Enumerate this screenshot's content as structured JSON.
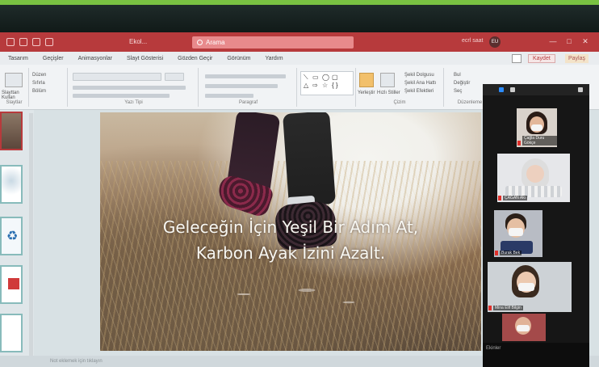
{
  "window": {
    "doc_title": "Ekol...",
    "search_placeholder": "Arama",
    "user_name": "ecrl saat",
    "user_initials": "EU",
    "control_minimize": "—",
    "control_maximize": "□",
    "control_close": "✕"
  },
  "tabs": [
    {
      "label": "Tasarım",
      "active": false
    },
    {
      "label": "Geçişler",
      "active": false
    },
    {
      "label": "Animasyonlar",
      "active": false
    },
    {
      "label": "Slayt Gösterisi",
      "active": false
    },
    {
      "label": "Gözden Geçir",
      "active": false
    },
    {
      "label": "Görünüm",
      "active": false
    },
    {
      "label": "Yardım",
      "active": false
    }
  ],
  "tab_actions": {
    "record_label": "Kaydet",
    "share_label": "Paylaş"
  },
  "ribbon": {
    "groups": [
      {
        "label": "Slaytlar"
      },
      {
        "label": "Yazı Tipi"
      },
      {
        "label": "Paragraf"
      },
      {
        "label": "Çizim"
      },
      {
        "label": "Düzenleme"
      }
    ],
    "new_slide_label": "Slayttan Kullan",
    "layout_label": "Düzen",
    "reset_label": "Sıfırla",
    "section_label": "Bölüm",
    "arrange_label": "Yerleştir",
    "quick_styles_label": "Hızlı Stiller",
    "shape_fill_label": "Şekil Dolgusu",
    "shape_outline_label": "Şekil Ana Hattı",
    "shape_effects_label": "Şekil Efektleri",
    "find_label": "Bul",
    "replace_label": "Değiştir",
    "select_label": "Seç"
  },
  "slide": {
    "line1": "Geleceğin İçin Yeşil Bir Adım At,",
    "line2": "Karbon Ayak İzini Azalt."
  },
  "status": {
    "notes_hint": "Not eklemek için tıklayın"
  },
  "zoom": {
    "participants": [
      {
        "name": "Çağla Duru Gökçe",
        "muted": true
      },
      {
        "name": "ÇAĞAN Akı",
        "muted": true
      },
      {
        "name": "Burak Bek",
        "muted": true
      },
      {
        "name": "Mina Elif Bilgin",
        "muted": true
      },
      {
        "name": "Ekinler",
        "muted": false
      }
    ]
  },
  "colors": {
    "titlebar": "#b73a3c",
    "accent_green": "#79c142",
    "zoom_bg": "#161616"
  }
}
